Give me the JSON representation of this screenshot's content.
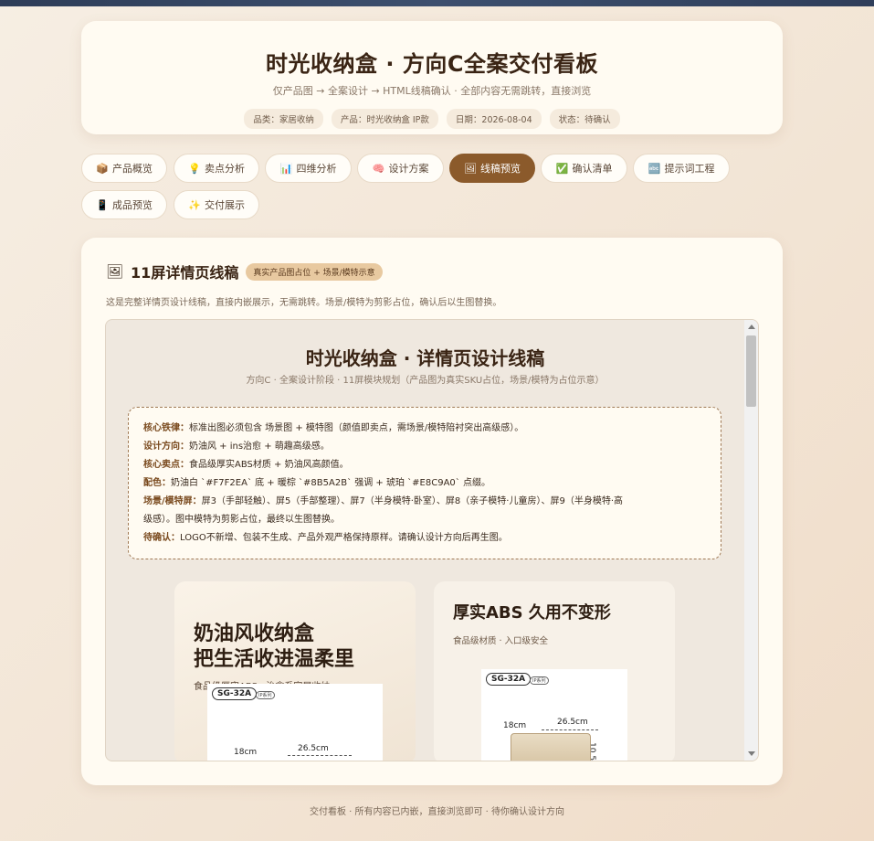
{
  "header": {
    "title": "时光收纳盒 · 方向C全案交付看板",
    "subtitle": "仅产品图 → 全案设计 → HTML线稿确认 · 全部内容无需跳转，直接浏览",
    "meta": [
      "品类：家居收纳",
      "产品：时光收纳盒 IP款",
      "日期：2026-08-04",
      "状态：待确认"
    ]
  },
  "tabs": [
    {
      "label": "产品概览",
      "icon": "📦"
    },
    {
      "label": "卖点分析",
      "icon": "💡"
    },
    {
      "label": "四维分析",
      "icon": "📊"
    },
    {
      "label": "设计方案",
      "icon": "🧠"
    },
    {
      "label": "线稿预览",
      "icon": "🖼",
      "active": true
    },
    {
      "label": "确认清单",
      "icon": "✅"
    },
    {
      "label": "提示词工程",
      "icon": "🔤"
    },
    {
      "label": "成品预览",
      "icon": "📱"
    },
    {
      "label": "交付展示",
      "icon": "✨"
    }
  ],
  "section": {
    "icon": "🖼",
    "title": "11屏详情页线稿",
    "badge": "真实产品图占位 + 场景/模特示意",
    "desc": "这是完整详情页设计线稿，直接内嵌展示，无需跳转。场景/模特为剪影占位，确认后以生图替换。"
  },
  "doc": {
    "title": "时光收纳盒 · 详情页设计线稿",
    "subtitle": "方向C · 全案设计阶段 · 11屏模块规划（产品图为真实SKU占位，场景/模特为占位示意）",
    "rules": [
      {
        "label": "核心铁律：",
        "text": "标准出图必须包含 场景图 + 模特图（颜值即卖点，需场景/模特陪衬突出高级感）。"
      },
      {
        "label": "设计方向：",
        "text": "奶油风 + ins治愈 + 萌趣高级感。"
      },
      {
        "label": "核心卖点：",
        "text": "食品级厚实ABS材质 + 奶油风高颜值。"
      },
      {
        "label": "配色：",
        "text": "奶油白 `#F7F2EA` 底 + 暖棕 `#8B5A2B` 强调 + 琥珀 `#E8C9A0` 点缀。"
      },
      {
        "label": "场景/模特屏：",
        "text": "屏3（手部轻触）、屏5（手部整理）、屏7（半身模特·卧室）、屏8（亲子模特·儿童房）、屏9（半身模特·高"
      },
      {
        "label": "",
        "text": "级感）。图中模特为剪影占位，最终以生图替换。"
      },
      {
        "label": "待确认：",
        "text": "LOGO不新增、包装不生成、产品外观严格保持原样。请确认设计方向后再生图。"
      }
    ],
    "panel_left": {
      "title_line1": "奶油风收纳盒",
      "title_line2": "把生活收进温柔里",
      "sub": "食品级厚实ABS · 治愈系家居收纳"
    },
    "panel_right": {
      "title": "厚实ABS 久用不变形",
      "sub": "食品级材质 · 入口级安全"
    },
    "product": {
      "sku": "SG-32A",
      "mini": "IP系列",
      "width": "26.5cm",
      "length": "18cm",
      "height": "10.5"
    }
  },
  "footer": "交付看板 · 所有内容已内嵌，直接浏览即可 · 待你确认设计方向"
}
